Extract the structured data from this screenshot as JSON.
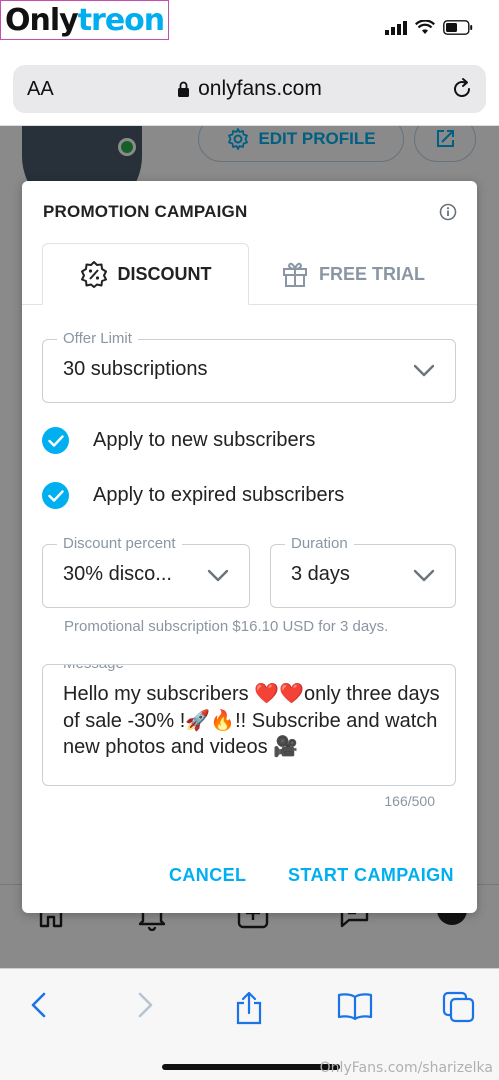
{
  "watermark": {
    "brand_prefix": "Only",
    "brand_suffix": "treon"
  },
  "status_bar": {
    "signal": "signal-icon",
    "wifi": "wifi-icon",
    "battery": "battery-icon"
  },
  "address_bar": {
    "text_size": "AA",
    "url": "onlyfans.com"
  },
  "profile": {
    "edit_label": "EDIT PROFILE"
  },
  "modal": {
    "title": "PROMOTION CAMPAIGN",
    "tabs": [
      {
        "label": "DISCOUNT",
        "icon": "discount-badge-icon",
        "active": true
      },
      {
        "label": "FREE TRIAL",
        "icon": "gift-icon",
        "active": false
      }
    ],
    "offer_limit": {
      "label": "Offer Limit",
      "value": "30 subscriptions"
    },
    "checkboxes": [
      {
        "label": "Apply to new subscribers",
        "checked": true
      },
      {
        "label": "Apply to expired subscribers",
        "checked": true
      }
    ],
    "discount_percent": {
      "label": "Discount percent",
      "value": "30% disco..."
    },
    "duration": {
      "label": "Duration",
      "value": "3 days"
    },
    "promo_note": "Promotional subscription $16.10 USD for 3 days.",
    "message": {
      "label": "Message",
      "text": "Hello my subscribers ❤️❤️only three days of sale -30% !🚀🔥!! Subscribe and watch new photos and videos 🎥",
      "counter": "166/500"
    },
    "cancel_label": "CANCEL",
    "start_label": "START CAMPAIGN"
  },
  "colors": {
    "accent": "#00aff0",
    "muted": "#8a96a3",
    "online": "#2ab24a"
  },
  "credit": "OnlyFans.com/sharizelka"
}
